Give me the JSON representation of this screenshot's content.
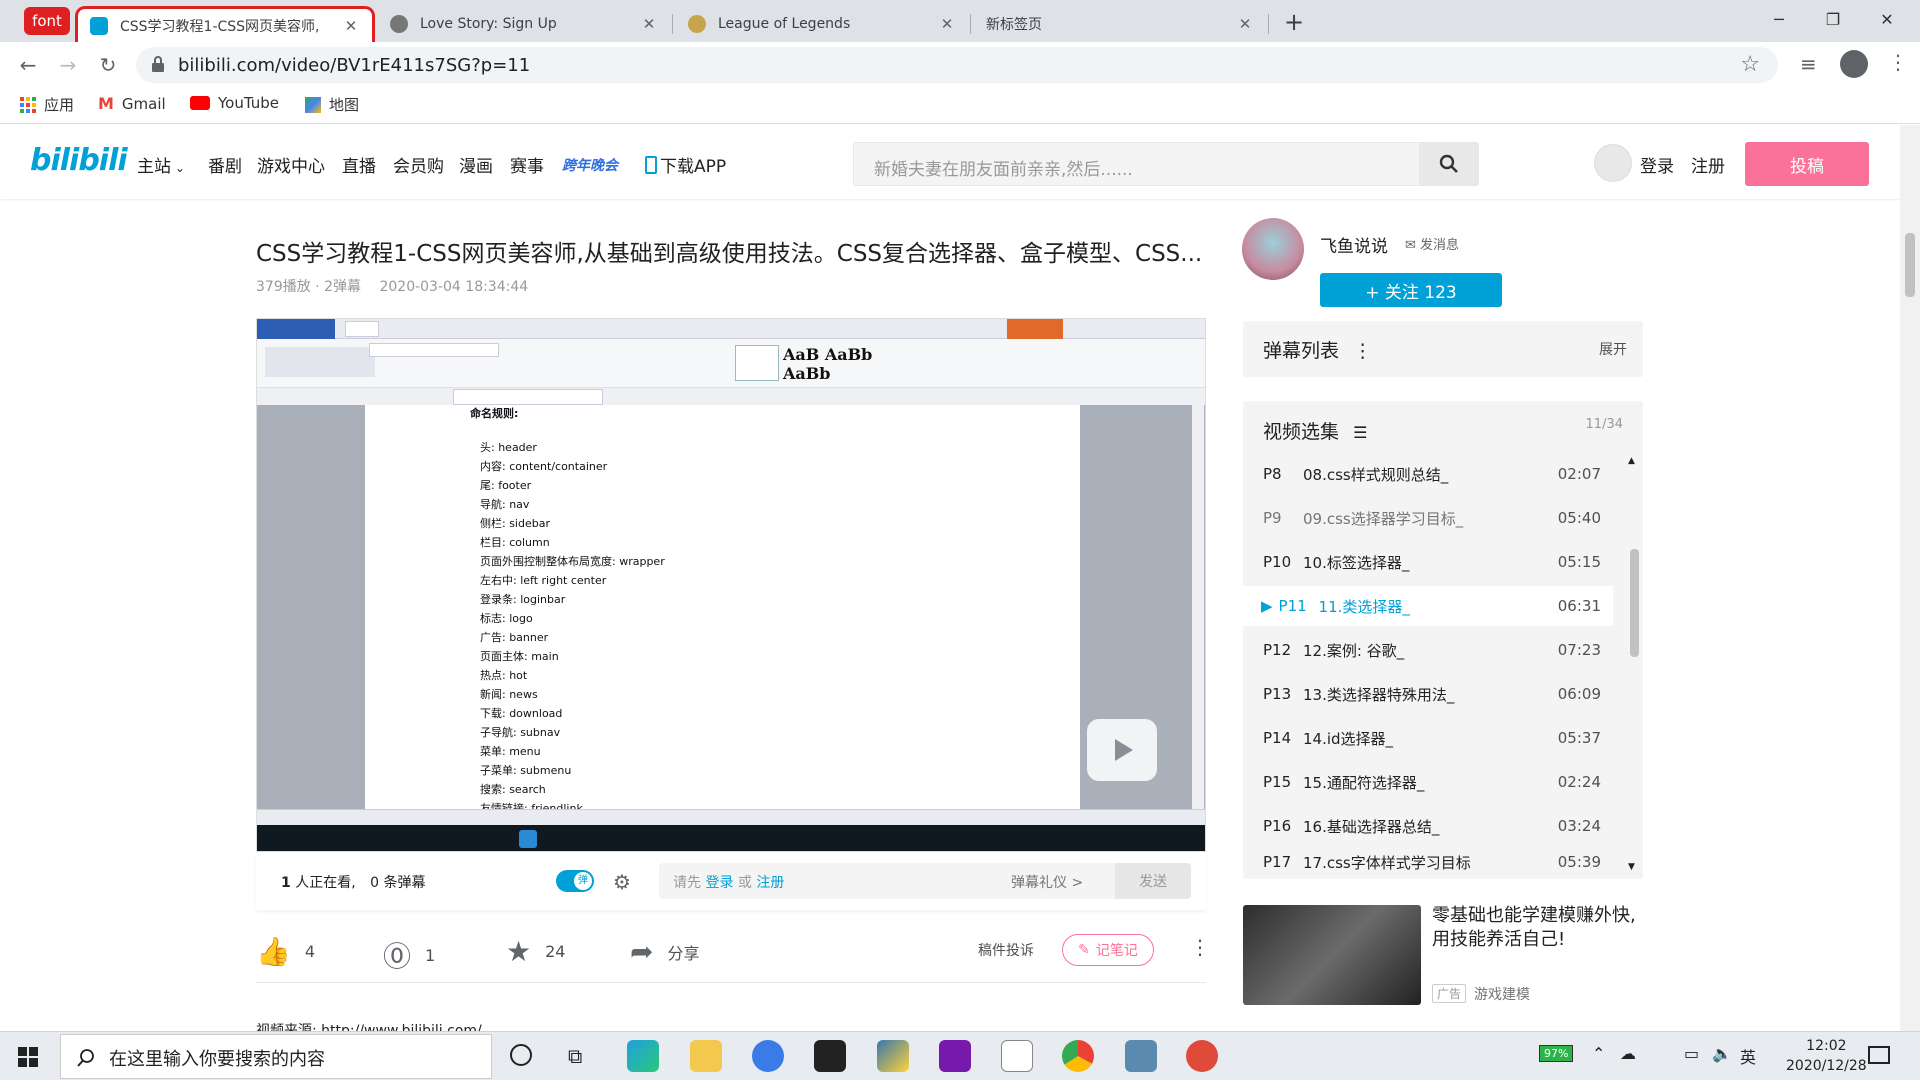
{
  "browser": {
    "font_badge": "font",
    "tabs": [
      {
        "title": "CSS学习教程1-CSS网页美容师,",
        "active": true
      },
      {
        "title": "Love Story: Sign Up",
        "active": false
      },
      {
        "title": "League of Legends",
        "active": false
      },
      {
        "title": "新标签页",
        "active": false
      }
    ],
    "new_tab": "+",
    "url": "bilibili.com/video/BV1rE411s7SG?p=11",
    "bookmarks": [
      {
        "label": "应用",
        "icon": "apps-grid-icon"
      },
      {
        "label": "Gmail",
        "icon": "gmail-icon"
      },
      {
        "label": "YouTube",
        "icon": "youtube-icon"
      },
      {
        "label": "地图",
        "icon": "maps-icon"
      }
    ]
  },
  "site": {
    "logo": "bilibili",
    "nav": [
      "主站",
      "番剧",
      "游戏中心",
      "直播",
      "会员购",
      "漫画",
      "赛事",
      "跨年晚会",
      "下载APP"
    ],
    "search_placeholder": "新婚夫妻在朋友面前亲亲,然后......",
    "login": "登录",
    "register": "注册",
    "upload": "投稿"
  },
  "video": {
    "title": "CSS学习教程1-CSS网页美容师,从基础到高级使用技法。CSS复合选择器、盒子模型、CSS...",
    "plays": "379播放",
    "danmaku_count": "2弹幕",
    "date": "2020-03-04 18:34:44",
    "doc_lines": [
      "命名规则:",
      "头: header",
      "内容: content/container",
      "尾: footer",
      "导航: nav",
      "侧栏: sidebar",
      "栏目: column",
      "页面外围控制整体布局宽度: wrapper",
      "左右中: left right center",
      "登录条: loginbar",
      "标志: logo",
      "广告: banner",
      "页面主体: main",
      "热点: hot",
      "新闻: news",
      "下载: download",
      "子导航: subnav",
      "菜单: menu",
      "子菜单: submenu",
      "搜索: search",
      "友情链接: friendlink"
    ],
    "watching_num": "1",
    "watching_text": "人正在看,",
    "danmaku_text": "0 条弹幕",
    "dm_toggle": "弹",
    "dm_tip_prefix": "请先",
    "dm_tip_login": "登录",
    "dm_tip_or": "或",
    "dm_tip_register": "注册",
    "dm_etiquette": "弹幕礼仪 >",
    "dm_send": "发送",
    "likes": "4",
    "coins": "1",
    "favs": "24",
    "share": "分享",
    "report": "稿件投诉",
    "note": "记笔记",
    "desc_partial": "视频来源: http://www.bilibili.com/..."
  },
  "uploader": {
    "name": "飞鱼说说",
    "message": "发消息",
    "follow": "+ 关注 123"
  },
  "danmaku_list": {
    "title": "弹幕列表",
    "expand": "展开"
  },
  "episodes": {
    "title": "视频选集",
    "count": "11/34",
    "items": [
      {
        "p": "P8",
        "title": "08.css样式规则总结_",
        "dur": "02:07"
      },
      {
        "p": "P9",
        "title": "09.css选择器学习目标_",
        "dur": "05:40"
      },
      {
        "p": "P10",
        "title": "10.标签选择器_",
        "dur": "05:15"
      },
      {
        "p": "P11",
        "title": "11.类选择器_",
        "dur": "06:31",
        "current": true
      },
      {
        "p": "P12",
        "title": "12.案例: 谷歌_",
        "dur": "07:23"
      },
      {
        "p": "P13",
        "title": "13.类选择器特殊用法_",
        "dur": "06:09"
      },
      {
        "p": "P14",
        "title": "14.id选择器_",
        "dur": "05:37"
      },
      {
        "p": "P15",
        "title": "15.通配符选择器_",
        "dur": "02:24"
      },
      {
        "p": "P16",
        "title": "16.基础选择器总结_",
        "dur": "03:24"
      },
      {
        "p": "P17",
        "title": "17.css字体样式学习目标",
        "dur": "05:39"
      }
    ]
  },
  "ad": {
    "text": "零基础也能学建模赚外快,用技能养活自己!",
    "tag": "广告",
    "source": "游戏建模"
  },
  "taskbar": {
    "search_placeholder": "在这里输入你要搜索的内容",
    "battery": "97%",
    "ime": "英",
    "time": "12:02",
    "date": "2020/12/28"
  },
  "colors": {
    "bilibili_blue": "#00a1d6",
    "bilibili_pink": "#fb7299",
    "tab_highlight": "#e02020"
  }
}
